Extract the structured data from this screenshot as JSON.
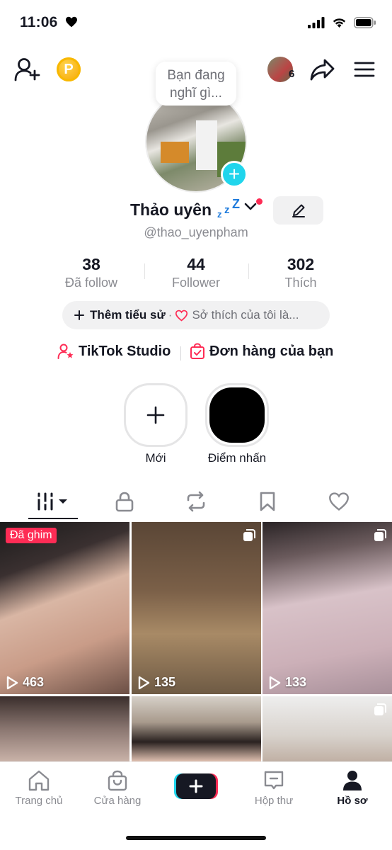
{
  "status_bar": {
    "time": "11:06",
    "icons": [
      "heart-icon",
      "signal-icon",
      "wifi-icon",
      "battery-icon"
    ]
  },
  "top_nav": {
    "friends_count": "6",
    "coin_label": "P"
  },
  "bubble": {
    "line1": "Bạn đang",
    "line2": "nghĩ gì..."
  },
  "profile": {
    "name": "Thảo uyên",
    "zzz": "zzZ",
    "handle": "@thao_uyenpham"
  },
  "stats": [
    {
      "value": "38",
      "label": "Đã follow"
    },
    {
      "value": "44",
      "label": "Follower"
    },
    {
      "value": "302",
      "label": "Thích"
    }
  ],
  "bio": {
    "add_label": "Thêm tiểu sử",
    "separator": "·",
    "hobby_label": "Sở thích của tôi là..."
  },
  "links": {
    "studio": "TikTok Studio",
    "orders": "Đơn hàng của bạn"
  },
  "highlights": [
    {
      "label": "Mới"
    },
    {
      "label": "Điểm nhấn"
    }
  ],
  "tabs": [
    "videos-tab",
    "private-tab",
    "reposts-tab",
    "favorites-tab",
    "liked-tab"
  ],
  "videos": [
    {
      "views": "463",
      "pinned_label": "Đã ghim"
    },
    {
      "views": "135"
    },
    {
      "views": "133"
    },
    {
      "views": ""
    },
    {
      "views": ""
    },
    {
      "views": ""
    }
  ],
  "bottom_nav": {
    "home": "Trang chủ",
    "shop": "Cửa hàng",
    "inbox": "Hộp thư",
    "profile": "Hồ sơ"
  },
  "colors": {
    "accent": "#fe2c55",
    "cyan": "#20d5ec",
    "text": "#161823",
    "muted": "#8a8b91"
  }
}
